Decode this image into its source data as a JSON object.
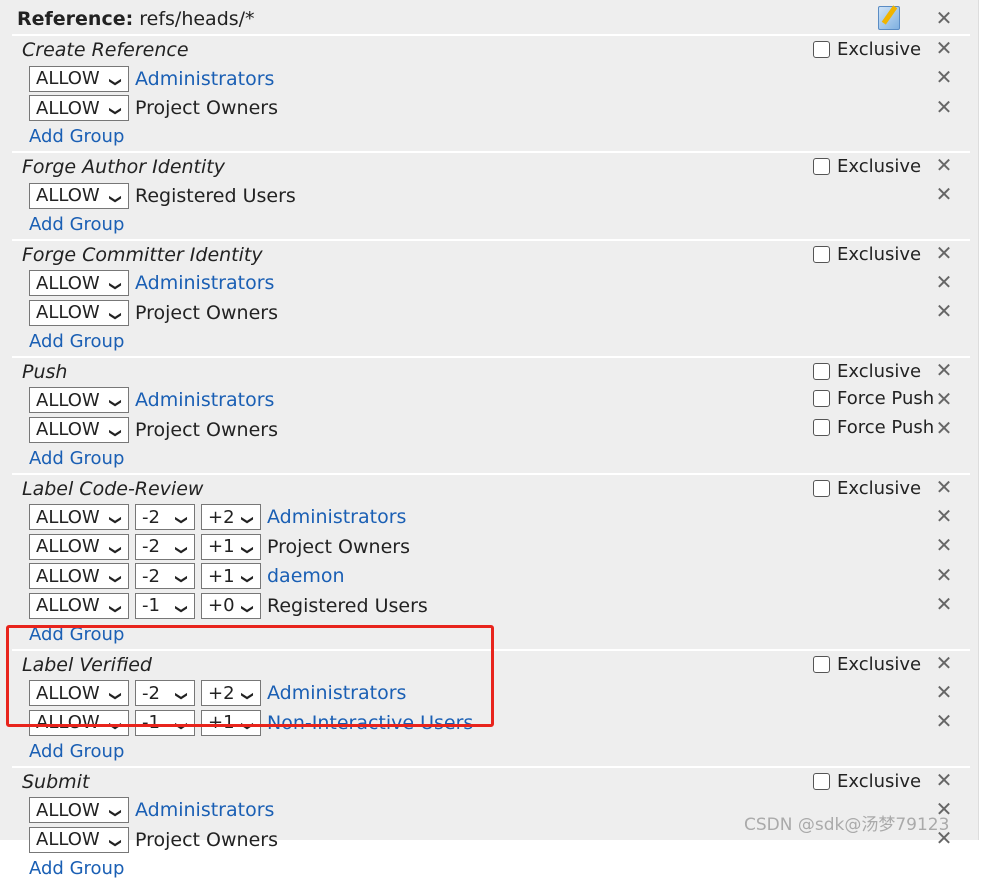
{
  "header": {
    "label": "Reference:",
    "pattern": "refs/heads/*",
    "edit_icon": "pencil-edit-icon",
    "delete_icon": "close-icon"
  },
  "add_group_label": "Add Group",
  "sections": [
    {
      "title": "Create Reference",
      "exclusive": "Exclusive",
      "rows": [
        {
          "action": "ALLOW",
          "group": "Administrators",
          "link": true
        },
        {
          "action": "ALLOW",
          "group": "Project Owners",
          "link": false
        }
      ]
    },
    {
      "title": "Forge Author Identity",
      "exclusive": "Exclusive",
      "rows": [
        {
          "action": "ALLOW",
          "group": "Registered Users",
          "link": false
        }
      ]
    },
    {
      "title": "Forge Committer Identity",
      "exclusive": "Exclusive",
      "rows": [
        {
          "action": "ALLOW",
          "group": "Administrators",
          "link": true
        },
        {
          "action": "ALLOW",
          "group": "Project Owners",
          "link": false
        }
      ]
    },
    {
      "title": "Push",
      "exclusive": "Exclusive",
      "rows": [
        {
          "action": "ALLOW",
          "group": "Administrators",
          "link": true,
          "option": "Force Push"
        },
        {
          "action": "ALLOW",
          "group": "Project Owners",
          "link": false,
          "option": "Force Push"
        }
      ]
    },
    {
      "title": "Label Code-Review",
      "exclusive": "Exclusive",
      "rows": [
        {
          "action": "ALLOW",
          "min": "-2",
          "max": "+2",
          "group": "Administrators",
          "link": true
        },
        {
          "action": "ALLOW",
          "min": "-2",
          "max": "+1",
          "group": "Project Owners",
          "link": false
        },
        {
          "action": "ALLOW",
          "min": "-2",
          "max": "+1",
          "group": "daemon",
          "link": true
        },
        {
          "action": "ALLOW",
          "min": "-1",
          "max": "+0",
          "group": "Registered Users",
          "link": false
        }
      ]
    },
    {
      "title": "Label Verified",
      "exclusive": "Exclusive",
      "rows": [
        {
          "action": "ALLOW",
          "min": "-2",
          "max": "+2",
          "group": "Administrators",
          "link": true
        },
        {
          "action": "ALLOW",
          "min": "-1",
          "max": "+1",
          "group": "Non-Interactive Users",
          "link": true
        }
      ]
    },
    {
      "title": "Submit",
      "exclusive": "Exclusive",
      "rows": [
        {
          "action": "ALLOW",
          "group": "Administrators",
          "link": true
        },
        {
          "action": "ALLOW",
          "group": "Project Owners",
          "link": false
        }
      ]
    }
  ],
  "watermark": "CSDN @sdk@汤梦79123",
  "colors": {
    "link": "#1a5fb4",
    "highlight": "#e8241c",
    "panel": "#eeeeee"
  }
}
